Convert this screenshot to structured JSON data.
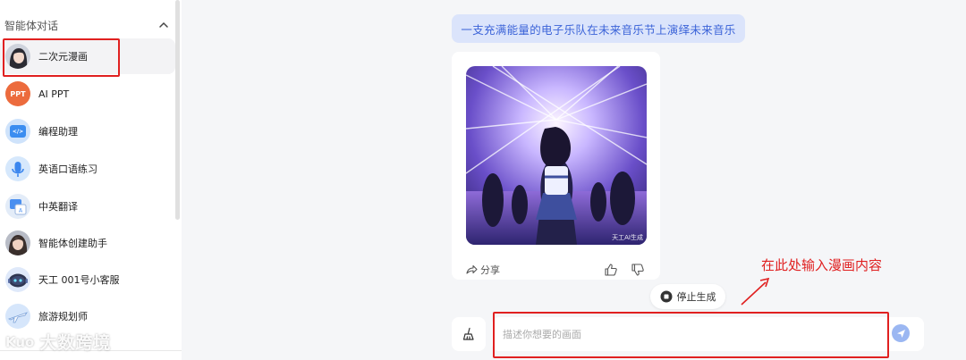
{
  "sidebar": {
    "section_title": "智能体对话",
    "items": [
      {
        "label": "二次元漫画",
        "icon": "anime-girl-avatar",
        "active": true
      },
      {
        "label": "AI PPT",
        "icon": "ppt-avatar",
        "avatar_text": "PPT"
      },
      {
        "label": "编程助理",
        "icon": "code-avatar",
        "avatar_text": "</>"
      },
      {
        "label": "英语口语练习",
        "icon": "microphone-avatar"
      },
      {
        "label": "中英翻译",
        "icon": "translate-avatar"
      },
      {
        "label": "智能体创建助手",
        "icon": "girl-avatar"
      },
      {
        "label": "天工 001号小客服",
        "icon": "robot-avatar"
      },
      {
        "label": "旅游规划师",
        "icon": "airplane-avatar"
      }
    ]
  },
  "chat": {
    "user_message": "一支充满能量的电子乐队在未来音乐节上演绎未来音乐",
    "image_watermark": "天工AI生成",
    "share_label": "分享",
    "stop_label": "停止生成",
    "input_placeholder": "描述你想要的画面"
  },
  "annotation": {
    "text": "在此处输入漫画内容"
  },
  "watermark": {
    "mark": "Kuo",
    "text": "大数跨境"
  },
  "colors": {
    "accent": "#3b63d8",
    "bubble": "#dbe4fb",
    "annotation_red": "#e02020",
    "send_button": "#9bb7f2"
  }
}
